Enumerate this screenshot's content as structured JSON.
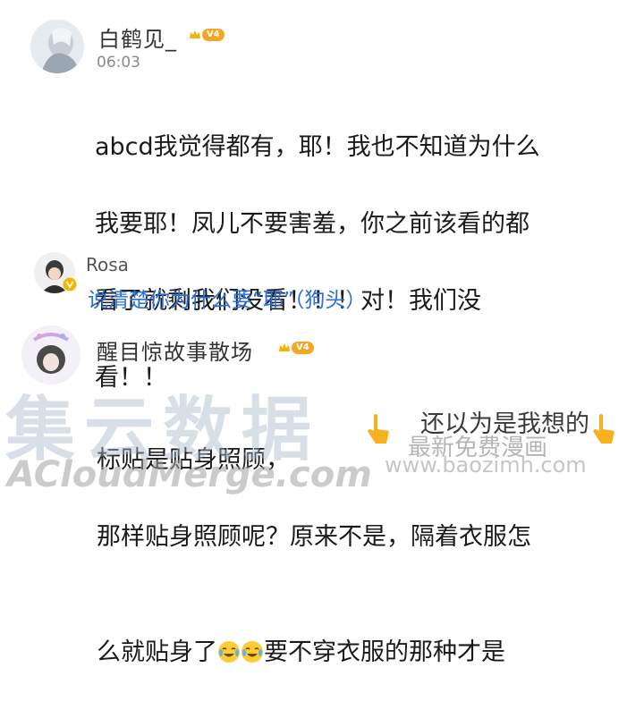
{
  "comments": [
    {
      "username": "白鹤见_",
      "badge": "V4",
      "time": "06:03",
      "text_lines": [
        "abcd我觉得都有，耶！我也不知道为什么",
        "我要耶！凤儿不要害羞，你之前该看的都",
        "看了就剩我们没看！！！对！我们没",
        "看！！"
      ]
    },
    {
      "username": "Rosa",
      "reply": "说清楚你为什么要“耶”（狗头）"
    },
    {
      "username": "醒目惊故事散场",
      "badge": "V4",
      "text_line1": "标贴是贴身照顾，",
      "text_line2": "那样贴身照顾呢？原来不是，隔着衣服怎",
      "text_line3_pre": "么就贴身了",
      "text_line3_post": "要不穿衣服的那种才是",
      "overlay_text": "还以为是我想的"
    }
  ],
  "watermarks": {
    "cn": "集云数据",
    "en": "ACloudMerge.com",
    "mid": "最新免费漫画",
    "site": "www.baozimh.com"
  },
  "colors": {
    "link": "#2c6fd6",
    "badge": "#f5a623"
  }
}
